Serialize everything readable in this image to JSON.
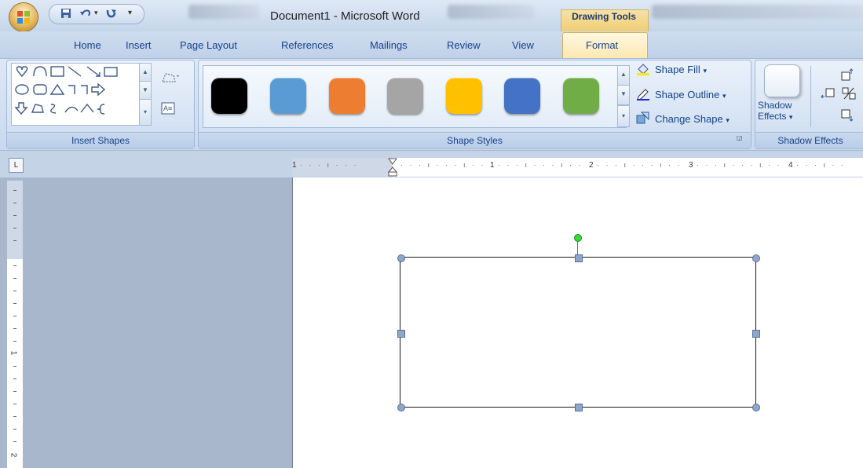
{
  "window": {
    "title": "Document1 - Microsoft Word",
    "contextual_tab_group": "Drawing Tools"
  },
  "tabs": [
    {
      "label": "Home",
      "selected": false
    },
    {
      "label": "Insert",
      "selected": false
    },
    {
      "label": "Page Layout",
      "selected": false
    },
    {
      "label": "References",
      "selected": false
    },
    {
      "label": "Mailings",
      "selected": false
    },
    {
      "label": "Review",
      "selected": false
    },
    {
      "label": "View",
      "selected": false
    },
    {
      "label": "Format",
      "selected": true
    }
  ],
  "ribbon": {
    "groups": {
      "insert_shapes": {
        "label": "Insert Shapes"
      },
      "shape_styles": {
        "label": "Shape Styles",
        "swatches": [
          "#000000",
          "#5b9bd5",
          "#ed7d31",
          "#a5a5a5",
          "#ffc000",
          "#4472c4",
          "#70ad47"
        ],
        "shape_fill": "Shape Fill",
        "shape_outline": "Shape Outline",
        "change_shape": "Change Shape"
      },
      "shadow_effects": {
        "label": "Shadow Effects",
        "button_line1": "Shadow",
        "button_line2": "Effects"
      }
    }
  },
  "ruler": {
    "corner": "L",
    "h_labels": [
      "1",
      "1",
      "2",
      "3",
      "4"
    ],
    "v_labels": [
      "1",
      "2"
    ]
  },
  "icons": [
    "office-button",
    "save-icon",
    "undo-icon",
    "redo-icon",
    "customize-qat-icon",
    "heart-shape-icon",
    "arc-shape-icon",
    "textbox-shape-icon",
    "line-shape-icon",
    "arrow-line-shape-icon",
    "rectangle-shape-icon",
    "oval-shape-icon",
    "rounded-rect-shape-icon",
    "triangle-shape-icon",
    "elbow-connector-icon",
    "right-arrow-shape-icon",
    "down-arrow-shape-icon",
    "freeform-shape-icon",
    "scribble-shape-icon",
    "curve-shape-icon",
    "brace-shape-icon",
    "edit-shape-icon",
    "draw-textbox-icon",
    "paint-bucket-icon",
    "pen-icon",
    "change-shape-icon",
    "shadow-effects-icon"
  ]
}
